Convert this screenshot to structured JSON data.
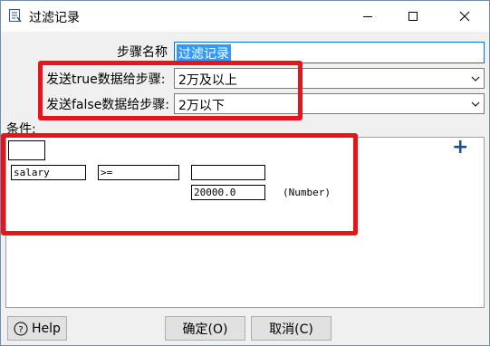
{
  "window": {
    "title": "过滤记录"
  },
  "form": {
    "step_name_label": "步骤名称",
    "step_name_value": "过滤记录",
    "true_label": "发送true数据给步骤:",
    "true_value": "2万及以上",
    "false_label": "发送false数据给步骤:",
    "false_value": "2万以下",
    "conditions_label": "条件:"
  },
  "condition": {
    "field": "salary",
    "operator": ">=",
    "value": "20000.0",
    "type": "(Number)",
    "add_symbol": "+"
  },
  "buttons": {
    "help": "Help",
    "ok": "确定(O)",
    "cancel": "取消(C)"
  },
  "colors": {
    "highlight": "#e8141c",
    "accent": "#0078d7",
    "add_icon": "#1f4f8b"
  }
}
